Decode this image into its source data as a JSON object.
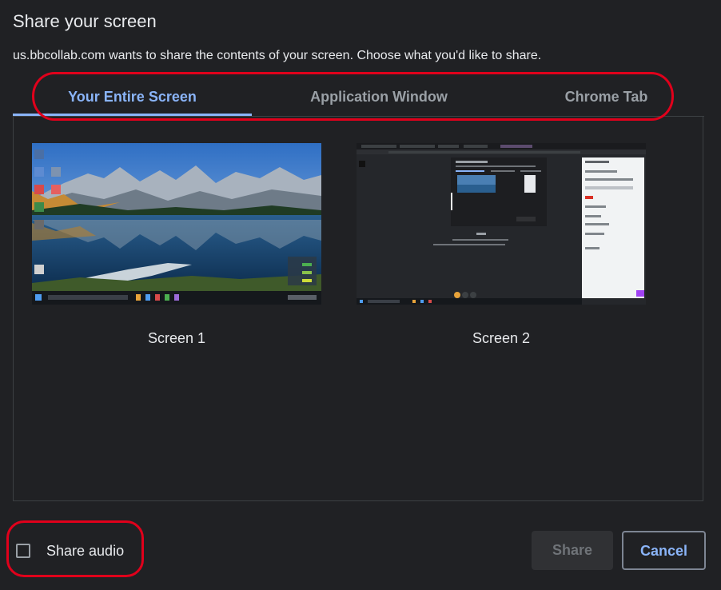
{
  "dialog": {
    "title": "Share your screen",
    "subtitle": "us.bbcollab.com wants to share the contents of your screen. Choose what you'd like to share."
  },
  "tabs": [
    {
      "label": "Your Entire Screen",
      "active": true
    },
    {
      "label": "Application Window",
      "active": false
    },
    {
      "label": "Chrome Tab",
      "active": false
    }
  ],
  "sources": [
    {
      "label": "Screen 1",
      "thumbnail": "desktop-mountain-lake-wallpaper"
    },
    {
      "label": "Screen 2",
      "thumbnail": "dark-browser-window"
    }
  ],
  "footer": {
    "audio_label": "Share audio",
    "audio_checked": false,
    "share_label": "Share",
    "cancel_label": "Cancel"
  },
  "colors": {
    "background": "#202124",
    "accent": "#8ab4f8",
    "annotation": "#e0001b"
  }
}
